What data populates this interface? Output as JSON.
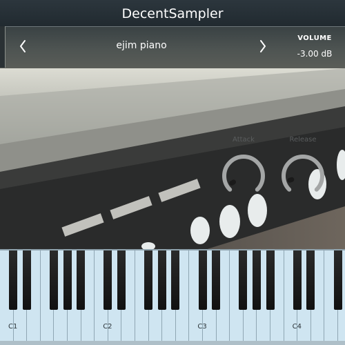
{
  "window": {
    "title": "DecentSampler"
  },
  "header": {
    "preset_name": "ejim piano",
    "prev_icon": "chevron-left-icon",
    "next_icon": "chevron-right-icon",
    "volume_label": "VOLUME",
    "volume_value": "-3.00 dB"
  },
  "controls": {
    "attack": {
      "label": "Attack",
      "level": 0.05
    },
    "release": {
      "label": "Release",
      "level": 0.1
    }
  },
  "keyboard": {
    "octave_labels": [
      "C1",
      "C2",
      "C3",
      "C4"
    ]
  },
  "colors": {
    "title_bar": "#252e34",
    "knob_track": "#a4a6a6",
    "knob_indicator": "#1a1a1a",
    "white_key": "#cfe5f1",
    "black_key": "#161616"
  }
}
